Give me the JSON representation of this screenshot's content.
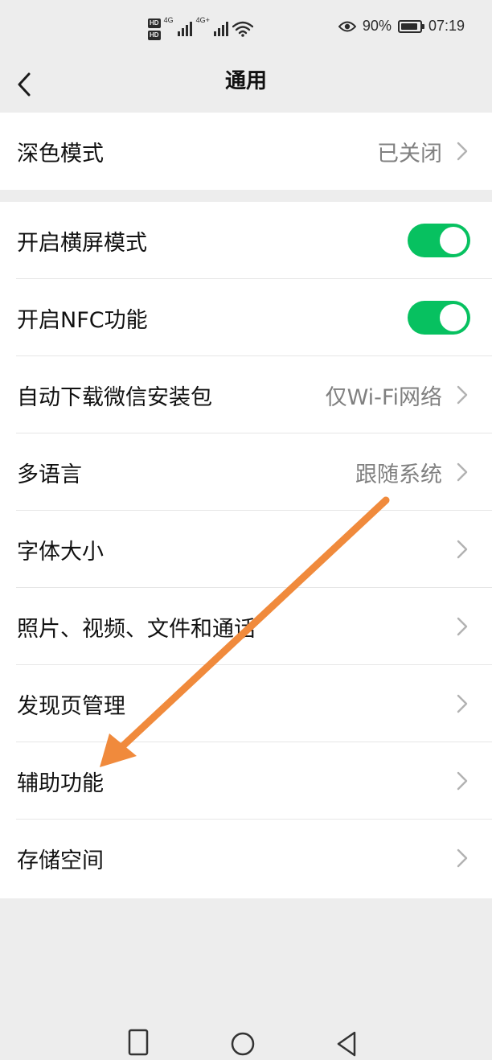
{
  "status_bar": {
    "hd_badges": [
      "HD",
      "HD"
    ],
    "network_labels": [
      "4G",
      "4G+"
    ],
    "battery_percent_text": "90%",
    "battery_level": 0.9,
    "time": "07:19",
    "icons": [
      "signal-icon",
      "wifi-icon",
      "eye-icon",
      "battery-icon"
    ]
  },
  "nav": {
    "title": "通用",
    "back_icon": "chevron-left-icon"
  },
  "settings": {
    "dark_mode": {
      "label": "深色模式",
      "value": "已关闭"
    },
    "landscape": {
      "label": "开启横屏模式",
      "enabled": true
    },
    "nfc": {
      "label": "开启NFC功能",
      "enabled": true
    },
    "auto_download": {
      "label": "自动下载微信安装包",
      "value": "仅Wi-Fi网络"
    },
    "language": {
      "label": "多语言",
      "value": "跟随系统"
    },
    "font_size": {
      "label": "字体大小"
    },
    "media": {
      "label": "照片、视频、文件和通话"
    },
    "discover": {
      "label": "发现页管理"
    },
    "accessibility": {
      "label": "辅助功能"
    },
    "storage": {
      "label": "存储空间"
    }
  },
  "colors": {
    "accent_green": "#07c160",
    "annotation_orange": "#f08a3c",
    "background": "#ededed"
  },
  "system_nav": {
    "icons": [
      "recent-apps-icon",
      "home-icon",
      "back-triangle-icon"
    ]
  }
}
